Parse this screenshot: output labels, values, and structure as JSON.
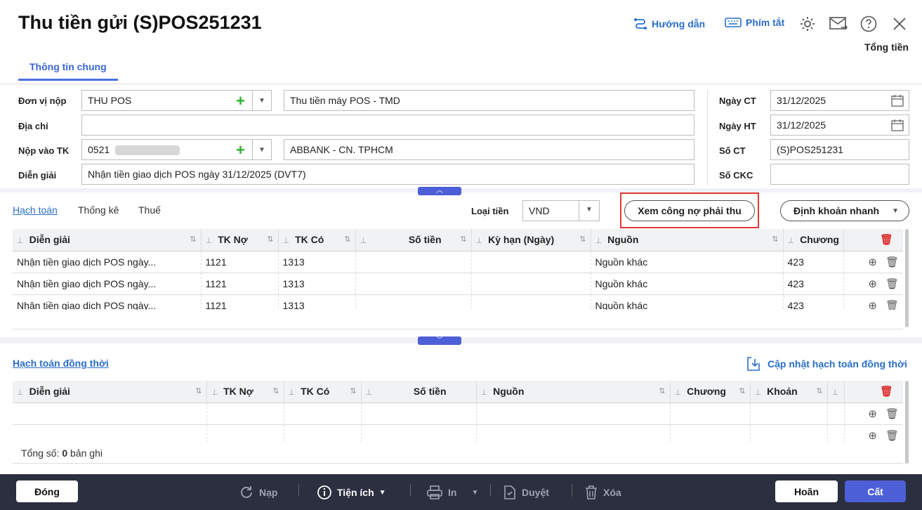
{
  "window": {
    "title": "Thu tiền gửi (S)POS251231",
    "guide_label": "Hướng dẫn",
    "shortcut_label": "Phím tắt",
    "total_label": "Tổng tiền"
  },
  "tabs": {
    "general": "Thông tin chung"
  },
  "form": {
    "payer_label": "Đơn vị nộp",
    "payer_value": "THU POS",
    "payer_name_value": "Thu tiền máy POS - TMD",
    "address_label": "Địa chỉ",
    "address_value": "",
    "account_label": "Nộp vào TK",
    "account_value": "0521 ",
    "bank_value": "ABBANK - CN. TPHCM",
    "desc_label": "Diễn giải",
    "desc_value": "Nhận tiền giao dịch POS ngày 31/12/2025 (DVT7)",
    "date_ct_label": "Ngày CT",
    "date_ct_value": "31/12/2025",
    "date_ht_label": "Ngày HT",
    "date_ht_value": "31/12/2025",
    "so_ct_label": "Số CT",
    "so_ct_value": "(S)POS251231",
    "so_ckc_label": "Số CKC",
    "so_ckc_value": ""
  },
  "detail_tabs": {
    "accounting": "Hạch toán",
    "statistics": "Thống kê",
    "tax": "Thuế",
    "currency_label": "Loại tiền",
    "currency_value": "VND",
    "view_debt_button": "Xem công nợ phải thu",
    "quick_entry_button": "Định khoản nhanh"
  },
  "grid1": {
    "headers": [
      "Diễn giải",
      "TK Nợ",
      "TK Có",
      "Số tiền",
      "Kỳ hạn (Ngày)",
      "Nguồn",
      "Chương"
    ],
    "rows": [
      [
        "Nhận tiền giao dịch POS ngày...",
        "1121",
        "1313",
        "",
        "",
        "Nguồn khác",
        "423"
      ],
      [
        "Nhận tiền giao dịch POS ngày...",
        "1121",
        "1313",
        "",
        "",
        "Nguồn khác",
        "423"
      ],
      [
        "Nhận tiền giao dịch POS ngày...",
        "1121",
        "1313",
        "",
        "",
        "Nguồn khác",
        "423"
      ]
    ]
  },
  "simultaneous": {
    "label": "Hạch toán đồng thời",
    "update_label": "Cập nhật hạch toán đồng thời"
  },
  "grid2": {
    "headers": [
      "Diễn giải",
      "TK Nợ",
      "TK Có",
      "Số tiền",
      "Nguồn",
      "Chương",
      "Khoản"
    ],
    "total_prefix": "Tổng số: ",
    "total_count": "0",
    "total_suffix": " bản ghi"
  },
  "footer": {
    "close": "Đóng",
    "reload": "Nạp",
    "utilities": "Tiện ích",
    "print": "In",
    "approve": "Duyệt",
    "delete": "Xóa",
    "cancel": "Hoãn",
    "save": "Cất"
  },
  "colors": {
    "accent": "#4c5fd7",
    "highlight": "#e53935",
    "link": "#2a6ec9"
  }
}
